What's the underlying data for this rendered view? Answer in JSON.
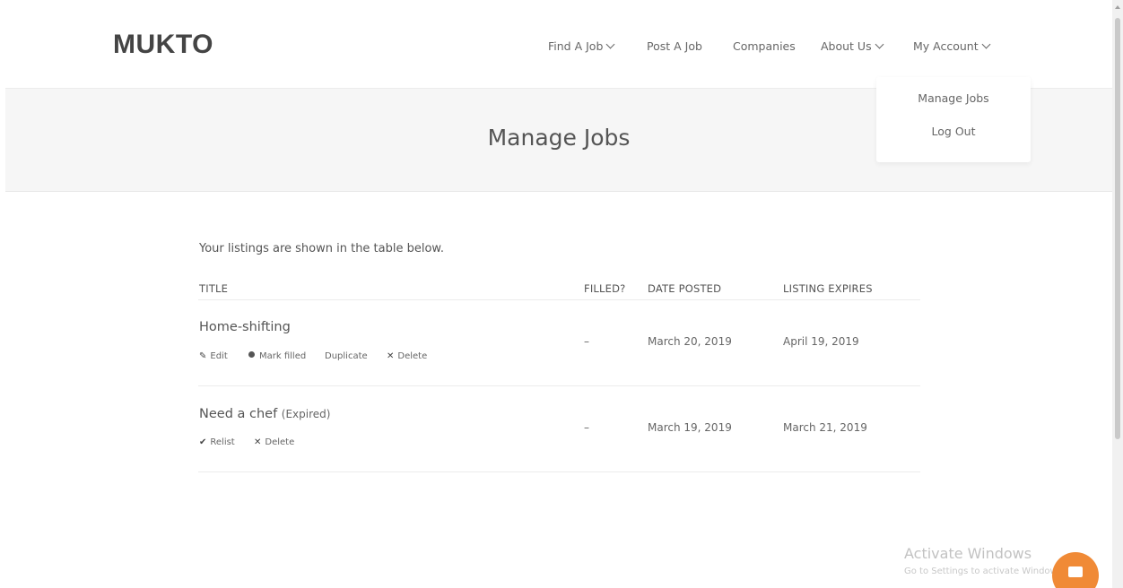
{
  "header": {
    "logo": "MUKTO",
    "nav": [
      {
        "label": "Find A Job",
        "has_dropdown": true
      },
      {
        "label": "Post A Job",
        "has_dropdown": false
      },
      {
        "label": "Companies",
        "has_dropdown": false
      },
      {
        "label": "About Us",
        "has_dropdown": true
      },
      {
        "label": "My Account",
        "has_dropdown": true
      }
    ]
  },
  "dropdown": {
    "items": [
      "Manage Jobs",
      "Log Out"
    ]
  },
  "banner": {
    "title": "Manage Jobs"
  },
  "listings": {
    "intro": "Your listings are shown in the table below.",
    "columns": [
      "TITLE",
      "FILLED?",
      "DATE POSTED",
      "LISTING EXPIRES"
    ],
    "rows": [
      {
        "title": "Home-shifting",
        "status": "",
        "filled": "–",
        "date_posted": "March 20, 2019",
        "expires": "April 19, 2019",
        "actions": [
          {
            "icon": "pencil-icon",
            "label": "Edit"
          },
          {
            "icon": "dot-icon",
            "label": "Mark filled"
          },
          {
            "icon": "",
            "label": "Duplicate"
          },
          {
            "icon": "x-icon",
            "label": "Delete"
          }
        ]
      },
      {
        "title": "Need a chef",
        "status": "(Expired)",
        "filled": "–",
        "date_posted": "March 19, 2019",
        "expires": "March 21, 2019",
        "actions": [
          {
            "icon": "check-icon",
            "label": "Relist"
          },
          {
            "icon": "x-icon",
            "label": "Delete"
          }
        ]
      }
    ]
  },
  "watermark": {
    "title": "Activate Windows",
    "subtitle": "Go to Settings to activate Windows."
  },
  "colors": {
    "accent": "#f08a36",
    "banner_bg": "#f6f6f6"
  }
}
